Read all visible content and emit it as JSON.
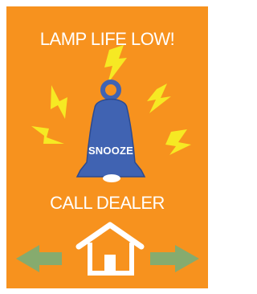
{
  "alert": {
    "title": "LAMP LIFE LOW!"
  },
  "snooze": {
    "label": "SNOOZE"
  },
  "message": {
    "text": "CALL DEALER"
  },
  "colors": {
    "background": "#f7921e",
    "bell": "#4063b2",
    "bell_outline": "#2b4a91",
    "lightning": "#f6e923",
    "arrow": "#86ab6e",
    "text": "#ffffff"
  },
  "icons": {
    "bell": "bell-icon",
    "lightning": "lightning-icon",
    "home": "home-icon",
    "left": "left-arrow-icon",
    "right": "right-arrow-icon"
  }
}
